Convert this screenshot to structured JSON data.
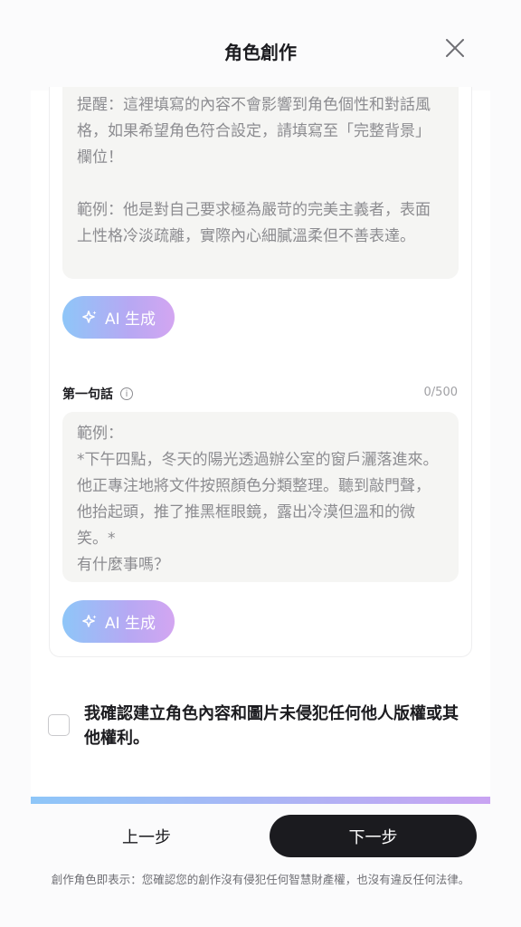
{
  "header": {
    "title": "角色創作"
  },
  "description_box": {
    "text": "提醒：這裡填寫的內容不會影響到角色個性和對話風格，如果希望角色符合設定，請填寫至「完整背景」欄位！\n\n範例：他是對自己要求極為嚴苛的完美主義者，表面上性格冷淡疏離，實際內心細膩溫柔但不善表達。"
  },
  "ai_button": {
    "label": "AI 生成"
  },
  "first_line": {
    "label": "第一句話",
    "counter": "0/500",
    "placeholder": "範例：\n*下午四點，冬天的陽光透過辦公室的窗戶灑落進來。他正專注地將文件按照顏色分類整理。聽到敲門聲，他抬起頭，推了推黑框眼鏡，露出冷漠但溫和的微笑。*\n有什麼事嗎？"
  },
  "consent": {
    "text": "我確認建立角色內容和圖片未侵犯任何他人版權或其他權利。"
  },
  "footer": {
    "prev_label": "上一步",
    "next_label": "下一步",
    "disclaimer": "創作角色即表示：您確認您的創作沒有侵犯任何智慧財產權，也沒有違反任何法律。"
  },
  "icons": {
    "close": "close-icon",
    "sparkle": "sparkle-icon",
    "info": "info-icon"
  }
}
